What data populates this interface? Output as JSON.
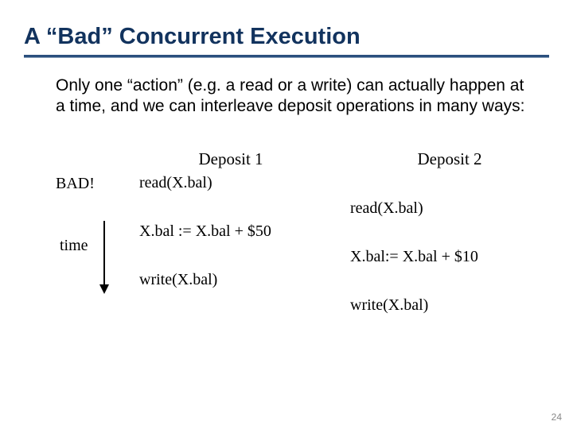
{
  "title": "A “Bad” Concurrent Execution",
  "body": "Only one “action” (e.g. a read or a write) can actually happen at a time, and we can interleave deposit operations in many ways:",
  "bad_label": "BAD!",
  "time_label": "time",
  "col1": {
    "header": "Deposit 1",
    "op1": "read(X.bal)",
    "op2": "X.bal := X.bal + $50",
    "op3": "write(X.bal)"
  },
  "col2": {
    "header": "Deposit 2",
    "op1": "read(X.bal)",
    "op2": "X.bal:= X.bal + $10",
    "op3": "write(X.bal)"
  },
  "page_number": "24"
}
